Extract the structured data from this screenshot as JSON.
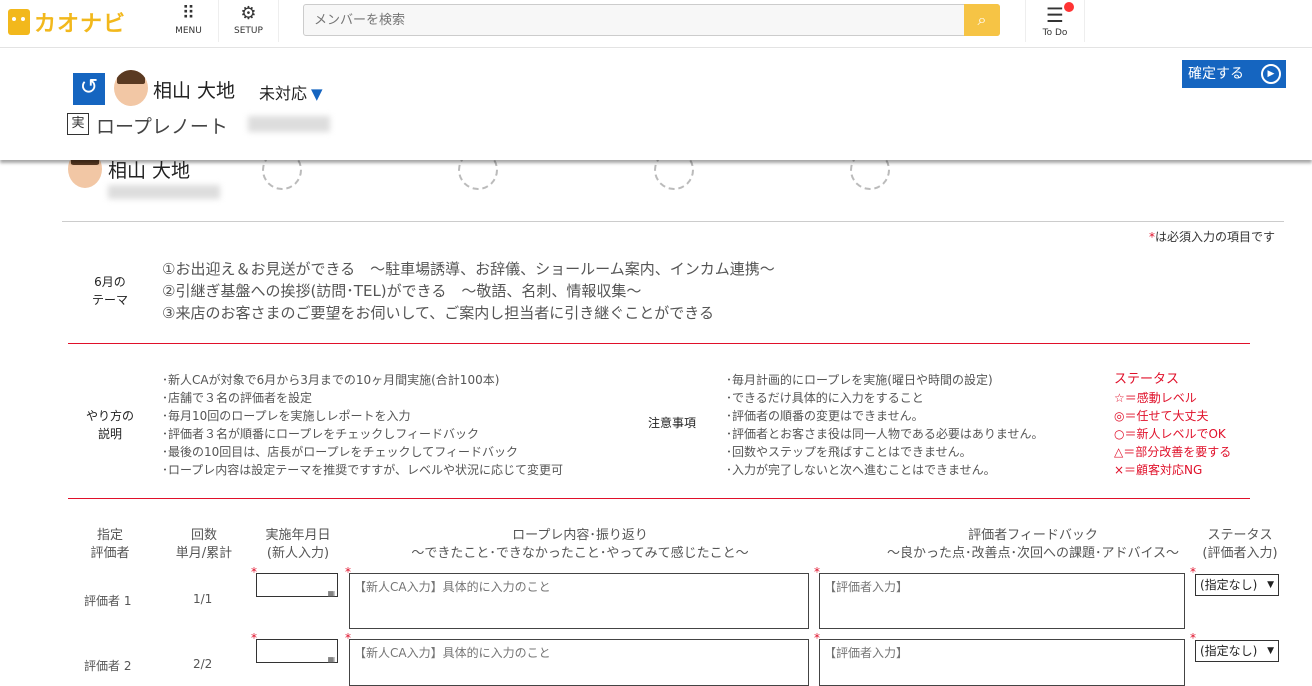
{
  "topbar": {
    "logo_text": "カオナビ",
    "menu_label": "MENU",
    "setup_label": "SETUP",
    "search_placeholder": "メンバーを検索",
    "todo_label": "To Do"
  },
  "header": {
    "person_name": "相山 大地",
    "status": "未対応",
    "confirm_label": "確定する",
    "note_badge": "実",
    "note_title": "ロープレノート"
  },
  "profile": {
    "name": "相山 大地"
  },
  "form": {
    "required_note": "は必須入力の項目です",
    "required_mark": "*",
    "theme_label_1": "6月の",
    "theme_label_2": "テーマ",
    "theme_lines": [
      "①お出迎え＆お見送ができる　～駐車場誘導、お辞儀、ショールーム案内、インカム連携～",
      "②引継ぎ基盤への挨拶(訪問･TEL)ができる　～敬語、名刺、情報収集～",
      "③来店のお客さまのご要望をお伺いして、ご案内し担当者に引き継ぐことができる"
    ],
    "how_label_1": "やり方の",
    "how_label_2": "説明",
    "how_lines": [
      "･新人CAが対象で6月から3月までの10ヶ月間実施(合計100本)",
      "･店舗で３名の評価者を設定",
      "･毎月10回のロープレを実施しレポートを入力",
      "･評価者３名が順番にロープレをチェックしフィードバック",
      "･最後の10回目は、店長がロープレをチェックしてフィードバック",
      "･ロープレ内容は設定テーマを推奨ですすが、レベルや状況に応じて変更可"
    ],
    "caution_label": "注意事項",
    "caution_lines": [
      "･毎月計画的にロープレを実施(曜日や時間の設定)",
      "･できるだけ具体的に入力をすること",
      "･評価者の順番の変更はできません。",
      "･評価者とお客さま役は同一人物である必要はありません。",
      "･回数やステップを飛ばすことはできません。",
      "･入力が完了しないと次へ進むことはできません。"
    ],
    "status_head": "ステータス",
    "status_lines": [
      "☆＝感動レベル",
      "◎＝任せて大丈夫",
      "○＝新人レベルでOK",
      "△＝部分改善を要する",
      "×＝顧客対応NG"
    ],
    "columns": {
      "evaluator_1": "指定",
      "evaluator_2": "評価者",
      "count_1": "回数",
      "count_2": "単月/累計",
      "date_1": "実施年月日",
      "date_2": "(新人入力)",
      "content_1": "ロープレ内容･振り返り",
      "content_2": "～できたこと･できなかったこと･やってみて感じたこと～",
      "feedback_1": "評価者フィードバック",
      "feedback_2": "～良かった点･改善点･次回への課題･アドバイス～",
      "status_1": "ステータス",
      "status_2": "(評価者入力)"
    },
    "rows": [
      {
        "evaluator": "評価者 1",
        "count": "1/1",
        "content_placeholder": "【新人CA入力】具体的に入力のこと",
        "feedback_placeholder": "【評価者入力】",
        "status": "(指定なし)"
      },
      {
        "evaluator": "評価者 2",
        "count": "2/2",
        "content_placeholder": "【新人CA入力】具体的に入力のこと",
        "feedback_placeholder": "【評価者入力】",
        "status": "(指定なし)"
      }
    ]
  },
  "colors": {
    "brand": "#f2b81c",
    "primary": "#1565c0",
    "required": "#e0102a"
  }
}
